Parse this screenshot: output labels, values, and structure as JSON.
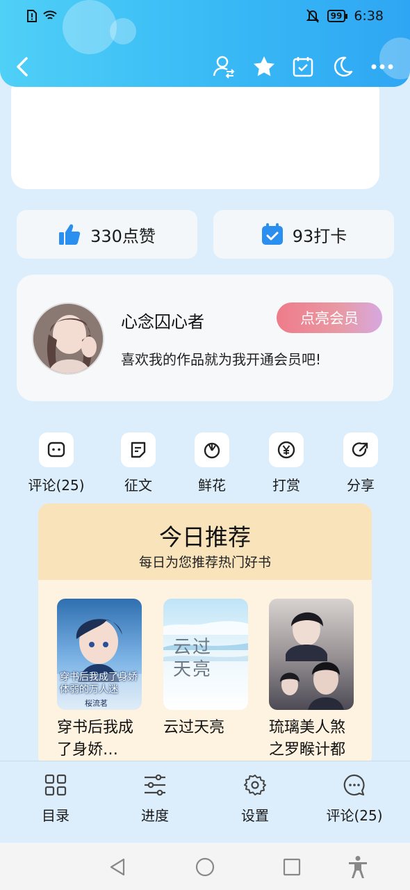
{
  "status": {
    "time": "6:38",
    "battery": "99"
  },
  "stats": {
    "likes": "330点赞",
    "checkins": "93打卡"
  },
  "author": {
    "name": "心念囚心者",
    "description": "喜欢我的作品就为我开通会员吧!",
    "vip_button": "点亮会员"
  },
  "actions": [
    {
      "label": "评论(25)",
      "icon": "comment-icon"
    },
    {
      "label": "征文",
      "icon": "essay-icon"
    },
    {
      "label": "鲜花",
      "icon": "flower-icon"
    },
    {
      "label": "打赏",
      "icon": "yuan-icon"
    },
    {
      "label": "分享",
      "icon": "share-icon"
    }
  ],
  "recommend": {
    "title": "今日推荐",
    "subtitle": "每日为您推荐热门好书",
    "books": [
      {
        "title": "穿书后我成了身娇…",
        "cover_text": "穿书后我成了身娇体弱的万人迷",
        "cover_author": "桜流茗"
      },
      {
        "title": "云过天亮",
        "cover_text": "云过天亮"
      },
      {
        "title": "琉璃美人煞之罗睺计都",
        "cover_text": ""
      }
    ]
  },
  "bottom_nav": [
    {
      "label": "目录",
      "icon": "grid-icon"
    },
    {
      "label": "进度",
      "icon": "sliders-icon"
    },
    {
      "label": "设置",
      "icon": "gear-icon"
    },
    {
      "label": "评论(25)",
      "icon": "chat-icon"
    }
  ]
}
